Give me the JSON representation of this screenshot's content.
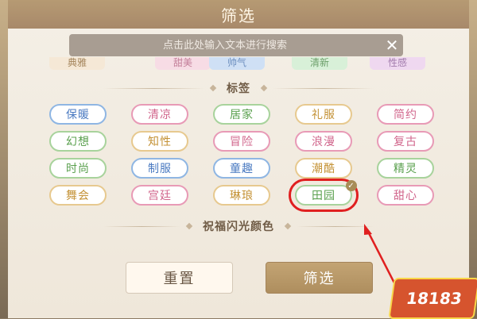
{
  "header": {
    "title": "筛选"
  },
  "search": {
    "placeholder": "点击此处输入文本进行搜索"
  },
  "style_tabs": [
    {
      "label": "典雅",
      "color": "#f5e8d6",
      "text": "#a5865d"
    },
    {
      "label": "甜美",
      "color": "#f7dce5",
      "text": "#c37d98"
    },
    {
      "label": "帅气",
      "color": "#cfe0f5",
      "text": "#6d8fbf"
    },
    {
      "label": "清新",
      "color": "#d8f0d8",
      "text": "#6da06b"
    },
    {
      "label": "性感",
      "color": "#efd8f0",
      "text": "#a27cad"
    }
  ],
  "section": {
    "tags_title": "标签",
    "color_title": "祝福闪光颜色"
  },
  "tags": [
    {
      "label": "保暖",
      "border": "#8fb6e3",
      "text": "#4a7ac1"
    },
    {
      "label": "清凉",
      "border": "#e89ab6",
      "text": "#d1668c"
    },
    {
      "label": "居家",
      "border": "#a8d39c",
      "text": "#5aa04e"
    },
    {
      "label": "礼服",
      "border": "#e7c98f",
      "text": "#c49236"
    },
    {
      "label": "简约",
      "border": "#e89ab6",
      "text": "#d1668c"
    },
    {
      "label": "幻想",
      "border": "#a8d39c",
      "text": "#5aa04e"
    },
    {
      "label": "知性",
      "border": "#e7c98f",
      "text": "#c49236"
    },
    {
      "label": "冒险",
      "border": "#e89ab6",
      "text": "#d1668c"
    },
    {
      "label": "浪漫",
      "border": "#e89ab6",
      "text": "#d1668c"
    },
    {
      "label": "复古",
      "border": "#e89ab6",
      "text": "#d1668c"
    },
    {
      "label": "时尚",
      "border": "#a8d39c",
      "text": "#5aa04e"
    },
    {
      "label": "制服",
      "border": "#8fb6e3",
      "text": "#4a7ac1"
    },
    {
      "label": "童趣",
      "border": "#8fb6e3",
      "text": "#4a7ac1"
    },
    {
      "label": "潮酷",
      "border": "#e7c98f",
      "text": "#c49236"
    },
    {
      "label": "精灵",
      "border": "#a8d39c",
      "text": "#5aa04e"
    },
    {
      "label": "舞会",
      "border": "#e7c98f",
      "text": "#c49236"
    },
    {
      "label": "宫廷",
      "border": "#e89ab6",
      "text": "#d1668c"
    },
    {
      "label": "琳琅",
      "border": "#e7c98f",
      "text": "#c49236"
    },
    {
      "label": "田园",
      "border": "#a8d39c",
      "text": "#5aa04e",
      "selected": true
    },
    {
      "label": "甜心",
      "border": "#e89ab6",
      "text": "#d1668c"
    }
  ],
  "buttons": {
    "reset": "重置",
    "filter": "筛选"
  },
  "colors": {
    "highlight": "#e02020",
    "check": "#a88d57"
  },
  "watermark": {
    "text": "18183"
  }
}
